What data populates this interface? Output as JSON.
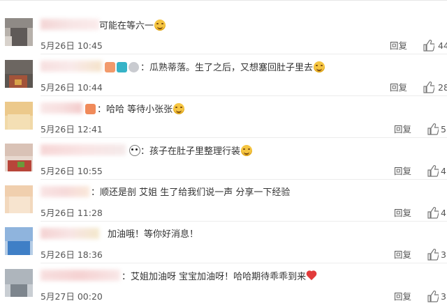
{
  "comments": [
    {
      "text": "可能在等六一",
      "date": "5月26日 10:45",
      "reply_label": "回复",
      "likes": "44"
    },
    {
      "text": "：瓜熟蒂落。生了之后，又想塞回肚子里去",
      "date": "5月26日 10:44",
      "reply_label": "回复",
      "likes": "28"
    },
    {
      "text": "：哈哈 等待小张张",
      "date": "5月26日 12:41",
      "reply_label": "回复",
      "likes": "5"
    },
    {
      "text": "：孩子在肚子里整理行装",
      "date": "5月26日 10:55",
      "reply_label": "回复",
      "likes": "4"
    },
    {
      "text": "：顺还是剖 艾姐 生了给我们说一声 分享一下经验",
      "date": "5月26日 11:28",
      "reply_label": "回复",
      "likes": "4"
    },
    {
      "text": "加油哦！等你好消息！",
      "date": "5月26日 18:36",
      "reply_label": "回复",
      "likes": "3"
    },
    {
      "text": "：艾姐加油呀 宝宝加油呀！哈哈期待乖乖到来",
      "date": "5月27日 00:20",
      "reply_label": "回复",
      "likes": "3"
    }
  ],
  "icons": {
    "like": "thumbs-up-icon",
    "emoji_smile": "smile-emoji-icon",
    "emoji_panda": "panda-emoji-icon",
    "emoji_heart": "heart-emoji-icon"
  },
  "colors": {
    "text": "#333333",
    "meta": "#555555",
    "separator": "#ececec",
    "heart": "#e23b3b"
  }
}
